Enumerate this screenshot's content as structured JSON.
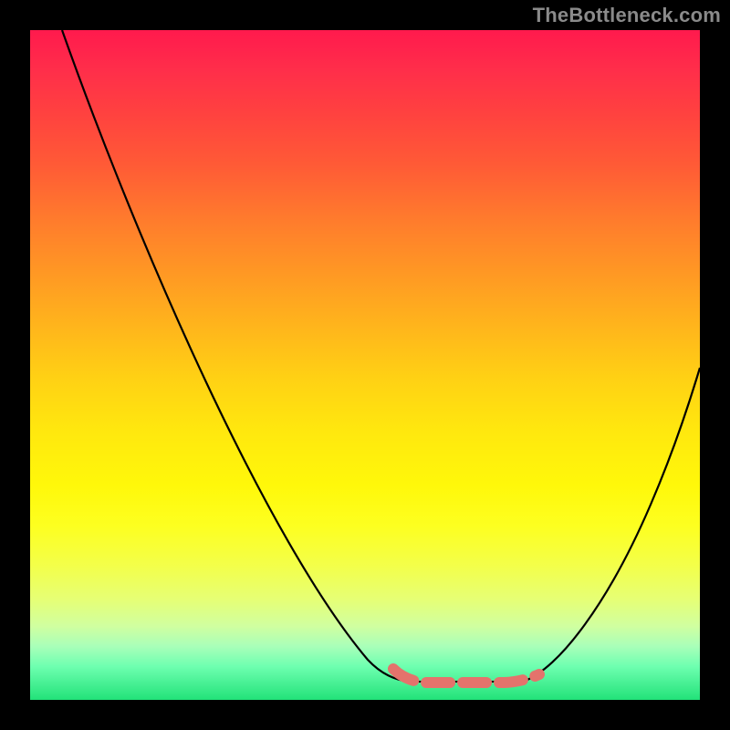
{
  "watermark": "TheBottleneck.com",
  "colors": {
    "gradient_top": "#ff1a4d",
    "gradient_mid": "#ffd114",
    "gradient_bottom": "#22e279",
    "curve": "#000000",
    "marker": "#e4736c",
    "frame": "#000000",
    "watermark_text": "#8a8a8a"
  },
  "chart_data": {
    "type": "line",
    "title": "",
    "xlabel": "",
    "ylabel": "",
    "xlim": [
      0,
      100
    ],
    "ylim": [
      0,
      100
    ],
    "grid": false,
    "legend": false,
    "series": [
      {
        "name": "left-branch",
        "x": [
          5,
          10,
          15,
          20,
          25,
          30,
          35,
          40,
          45,
          50,
          55,
          57
        ],
        "y": [
          100,
          90,
          79,
          68,
          57,
          46,
          35,
          25,
          16,
          9,
          4,
          3
        ]
      },
      {
        "name": "plateau",
        "x": [
          57,
          60,
          65,
          70,
          73
        ],
        "y": [
          3,
          2.7,
          2.6,
          2.7,
          3
        ]
      },
      {
        "name": "right-branch",
        "x": [
          73,
          78,
          83,
          88,
          93,
          100
        ],
        "y": [
          3,
          7,
          15,
          26,
          38,
          50
        ]
      }
    ],
    "annotations": [
      {
        "name": "optimum-dash",
        "style": "dashed-thick",
        "color": "#e4736c",
        "x": [
          54,
          57,
          60,
          65,
          70,
          73,
          76
        ],
        "y": [
          5,
          3.2,
          2.8,
          2.6,
          2.8,
          3.2,
          4.5
        ]
      }
    ],
    "background": {
      "type": "vertical-gradient",
      "stops": [
        {
          "pos": 0.0,
          "color": "#ff1a4d"
        },
        {
          "pos": 0.5,
          "color": "#ffd114"
        },
        {
          "pos": 0.85,
          "color": "#e6ff75"
        },
        {
          "pos": 1.0,
          "color": "#22e279"
        }
      ]
    }
  }
}
